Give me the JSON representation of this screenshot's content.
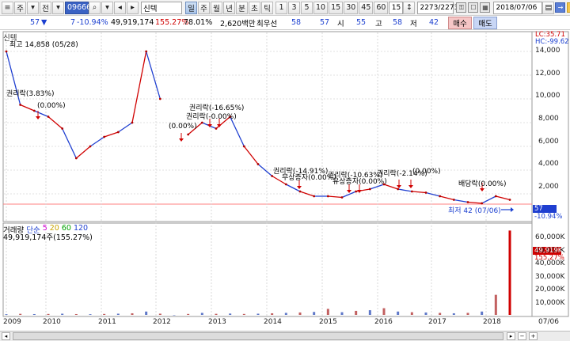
{
  "toolbar": {
    "period_select": "주",
    "code_prefix": "전",
    "stock_code": "096660",
    "stock_name": "신텍",
    "period_buttons": [
      "일",
      "주",
      "월",
      "년",
      "분",
      "초",
      "틱"
    ],
    "minute_buttons": [
      "1",
      "3",
      "5",
      "10",
      "15",
      "30",
      "45",
      "60"
    ],
    "custom_minute": "15",
    "count_display": "2273/2273",
    "date": "2018/07/06"
  },
  "quote": {
    "price": "57",
    "change": "7",
    "change_rate": "-10.94%",
    "volume": "49,919,174",
    "volume_rate": "155.27%",
    "turnover": "78.01%",
    "trade_value": "2,620백만",
    "condition": "최우선",
    "best_price": "58",
    "open_label": "시",
    "open": "57",
    "high_label": "고",
    "high": "55",
    "low_label": "저",
    "low": "58",
    "current_label": "",
    "current": "42",
    "buy_label": "매수",
    "sell_label": "매도"
  },
  "chart": {
    "name_label": "신텍",
    "max_label": "최고 14,858 (05/28)",
    "min_label": "최저 42 (07/06)",
    "lc_label": "LC:35.71",
    "hc_label": "HC:-99.62",
    "current_tag": "57",
    "current_rate_tag": "-10.94%",
    "price_ticks": [
      "14,000",
      "12,000",
      "10,000",
      "8,000",
      "6,000",
      "4,000",
      "2,000"
    ],
    "volume_ticks": [
      "60,000K",
      "50,000K",
      "40,000K",
      "30,000K",
      "20,000K",
      "10,000K"
    ],
    "volume_tag": "49,919K",
    "volume_rate_tag": "155.27%",
    "volume_legend_label": "거래량",
    "volume_legend_type": "단순",
    "volume_ma": [
      "5",
      "20",
      "60",
      "120"
    ],
    "volume_ma_colors": [
      "#d400d4",
      "#c9a400",
      "#00a000",
      "#1f3fd0"
    ],
    "volume_value_label": "49,919,174주(155.27%)",
    "year_labels": [
      "2009",
      "2010",
      "2011",
      "2012",
      "2013",
      "2014",
      "2015",
      "2016",
      "2017",
      "2018"
    ],
    "last_date_label": "07/06",
    "annotations": [
      {
        "text": "권리락(3.83%)"
      },
      {
        "text": "(0.00%)"
      },
      {
        "text": "권리락(-16.65%)"
      },
      {
        "text": "(0.00%)"
      },
      {
        "text": "권리락(-0.00%)"
      },
      {
        "text": "권리락(-14.91%)"
      },
      {
        "text": "무상증자(0.00%)"
      },
      {
        "text": "권리락(-10.63%)"
      },
      {
        "text": "유상증자(0.00%)"
      },
      {
        "text": "권리락(-2.14%)"
      },
      {
        "text": "(0.00%)"
      },
      {
        "text": "배당락(0.00%)"
      }
    ]
  },
  "chart_data": {
    "type": "line",
    "x": [
      "2009-01",
      "2009-04",
      "2009-07",
      "2009-10",
      "2010-01",
      "2010-04",
      "2010-07",
      "2010-10",
      "2011-01",
      "2011-04",
      "2011-05",
      "2011-07",
      "2012-01",
      "2012-07",
      "2013-01",
      "2013-04",
      "2013-07",
      "2013-10",
      "2014-01",
      "2014-04",
      "2014-07",
      "2014-10",
      "2015-01",
      "2015-04",
      "2015-07",
      "2015-10",
      "2016-01",
      "2016-04",
      "2016-07",
      "2016-10",
      "2017-01",
      "2017-04",
      "2017-07",
      "2017-10",
      "2018-01",
      "2018-04",
      "2018-07"
    ],
    "series": [
      {
        "values": [
          14000,
          9500,
          9000,
          8500,
          7500,
          5000,
          6000,
          6800,
          7200,
          8000,
          14000,
          10000,
          null,
          7000,
          8000,
          7500,
          8500,
          6000,
          4500,
          3500,
          2800,
          2200,
          1800,
          1800,
          1700,
          2200,
          2400,
          2800,
          2400,
          2200,
          2100,
          1800,
          1500,
          1300,
          1200,
          1800,
          1500
        ]
      }
    ],
    "ylim": [
      0,
      15000
    ],
    "volume": [
      500,
      800,
      600,
      700,
      900,
      600,
      500,
      700,
      900,
      1200,
      2500,
      900,
      0,
      700,
      1500,
      800,
      1000,
      700,
      900,
      1200,
      1500,
      1800,
      2200,
      4500,
      2000,
      3000,
      3500,
      5000,
      2500,
      2000,
      1800,
      1500,
      1200,
      1500,
      2500,
      15000,
      63000
    ],
    "volume_ylim": [
      0,
      65000
    ]
  }
}
